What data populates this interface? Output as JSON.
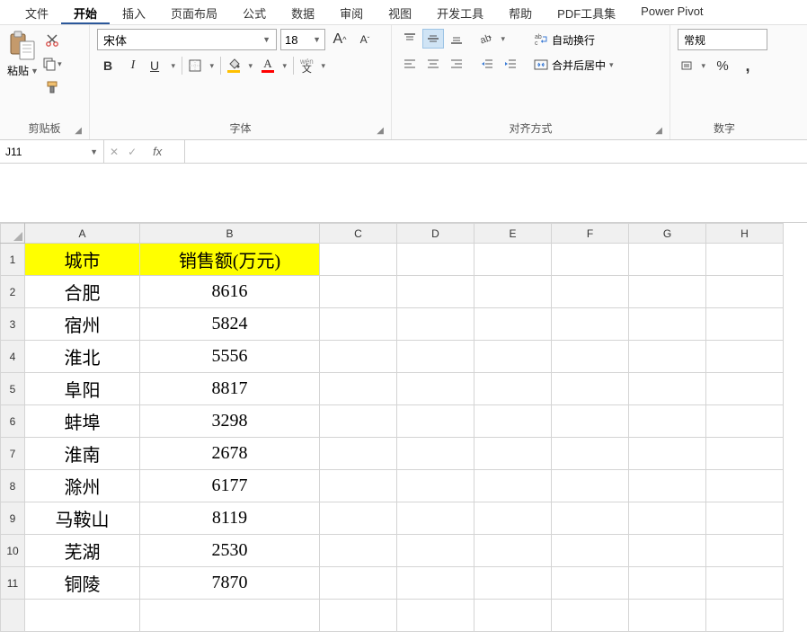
{
  "tabs": [
    "文件",
    "开始",
    "插入",
    "页面布局",
    "公式",
    "数据",
    "审阅",
    "视图",
    "开发工具",
    "帮助",
    "PDF工具集",
    "Power Pivot"
  ],
  "active_tab_index": 1,
  "clipboard": {
    "paste": "粘贴",
    "group_label": "剪贴板"
  },
  "font": {
    "name": "宋体",
    "size": "18",
    "bold": "B",
    "italic": "I",
    "underline": "U",
    "phonetic": "wén",
    "phonetic_sub": "文",
    "group_label": "字体",
    "grow": "A",
    "shrink": "A"
  },
  "align": {
    "wrap": "自动换行",
    "merge": "合并后居中",
    "group_label": "对齐方式"
  },
  "number": {
    "format": "常规",
    "group_label": "数字",
    "percent": "%",
    "comma": ","
  },
  "namebox": "J11",
  "fx_label": "fx",
  "columns": [
    "A",
    "B",
    "C",
    "D",
    "E",
    "F",
    "G",
    "H"
  ],
  "row_numbers": [
    "1",
    "2",
    "3",
    "4",
    "5",
    "6",
    "7",
    "8",
    "9",
    "10",
    "11"
  ],
  "sheet": {
    "header": {
      "city": "城市",
      "sales": "销售额(万元)"
    },
    "rows": [
      {
        "city": "合肥",
        "sales": "8616"
      },
      {
        "city": "宿州",
        "sales": "5824"
      },
      {
        "city": "淮北",
        "sales": "5556"
      },
      {
        "city": "阜阳",
        "sales": "8817"
      },
      {
        "city": "蚌埠",
        "sales": "3298"
      },
      {
        "city": "淮南",
        "sales": "2678"
      },
      {
        "city": "滁州",
        "sales": "6177"
      },
      {
        "city": "马鞍山",
        "sales": "8119"
      },
      {
        "city": "芜湖",
        "sales": "2530"
      },
      {
        "city": "铜陵",
        "sales": "7870"
      }
    ]
  },
  "chart_data": {
    "type": "table",
    "title": "销售额(万元)",
    "columns": [
      "城市",
      "销售额(万元)"
    ],
    "rows": [
      [
        "合肥",
        8616
      ],
      [
        "宿州",
        5824
      ],
      [
        "淮北",
        5556
      ],
      [
        "阜阳",
        8817
      ],
      [
        "蚌埠",
        3298
      ],
      [
        "淮南",
        2678
      ],
      [
        "滁州",
        6177
      ],
      [
        "马鞍山",
        8119
      ],
      [
        "芜湖",
        2530
      ],
      [
        "铜陵",
        7870
      ]
    ]
  }
}
